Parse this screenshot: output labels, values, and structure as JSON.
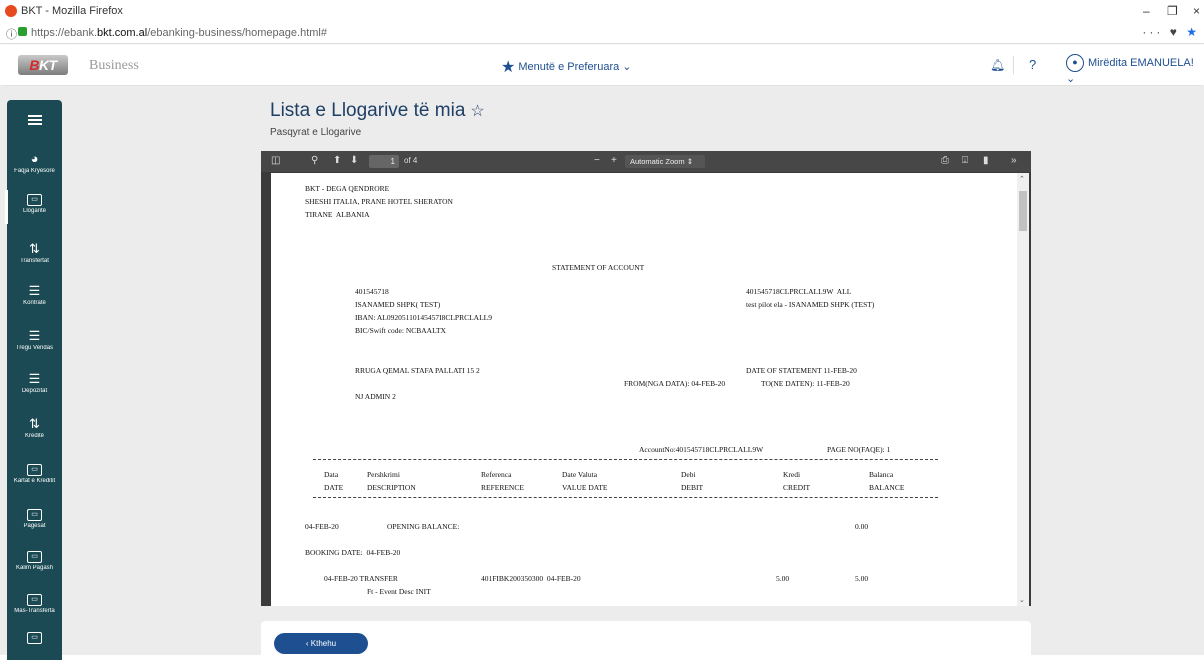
{
  "browser": {
    "window_title": "BKT - Mozilla Firefox",
    "url_prefix": "https://ebank.",
    "url_domain": "bkt.com.al",
    "url_path": "/ebanking-business/homepage.html#"
  },
  "header": {
    "logo_text": "BKT",
    "brand_sub": "Business",
    "favorites_menu": "Menutë e Preferuara",
    "help": "?",
    "user_name": "Mirëdita EMANUELA!"
  },
  "sidebar": {
    "items": [
      {
        "label": "Faqja Kryesore",
        "icon": "home-icon"
      },
      {
        "label": "Llogaritë",
        "icon": "accounts-icon"
      },
      {
        "label": "Transfertat",
        "icon": "transfer-icon"
      },
      {
        "label": "Kontratë",
        "icon": "contract-icon"
      },
      {
        "label": "Tregu Vendas",
        "icon": "market-icon"
      },
      {
        "label": "Depozitat",
        "icon": "deposit-icon"
      },
      {
        "label": "Kreditë",
        "icon": "credit-icon"
      },
      {
        "label": "Kartat e Kreditit",
        "icon": "card-icon"
      },
      {
        "label": "Pagesat",
        "icon": "payment-icon"
      },
      {
        "label": "Kalim Pagash",
        "icon": "payroll-icon"
      },
      {
        "label": "Mas-Transferta",
        "icon": "mass-transfer-icon"
      },
      {
        "label": "",
        "icon": "more-icon"
      }
    ]
  },
  "main": {
    "title": "Lista e Llogarive të mia",
    "breadcrumb": "Pasqyrat e Llogarive"
  },
  "pdf_viewer": {
    "page_current": "1",
    "page_total": "of 4",
    "zoom": "Automatic Zoom",
    "zoom_minus": "−",
    "zoom_plus": "+",
    "lines": {
      "bank1": "BKT - DEGA QENDRORE",
      "bank2": "SHESHI ITALIA, PRANE HOTEL SHERATON",
      "bank3": "TIRANE  ALBANIA",
      "statement_title": "STATEMENT OF ACCOUNT",
      "acct_no": "401545718",
      "acct_code": "401545718CLPRCLALL9W  ALL",
      "company": "ISANAMED SHPK( TEST)",
      "acct_desc": "test pilot ela - ISANAMED SHPK (TEST)",
      "iban": "IBAN: AL09205110145457I8CLPRCLALL9",
      "bic": "BIC/Swift code: NCBAALTX",
      "address": "RRUGA QEMAL STAFA PALLATI 15 2",
      "date_of_statement": "DATE OF STATEMENT 11-FEB-20",
      "from_date": "FROM(NGA DATA): 04-FEB-20",
      "to_date": "TO(NE DATEN): 11-FEB-20",
      "admin": "NJ ADMIN 2",
      "account_no_label": "AccountNo:401545718CLPRCLALL9W",
      "page_no": "PAGE NO(FAQE): 1",
      "col_data": "Data",
      "col_date": "DATE",
      "col_pershkrimi": "Pershkrimi",
      "col_description": "DESCRIPTION",
      "col_referenca": "Referenca",
      "col_reference": "REFERENCE",
      "col_date_valuta": "Date Valuta",
      "col_value_date": "VALUE DATE",
      "col_debi": "Debi",
      "col_debit": "DEBIT",
      "col_kredi": "Kredi",
      "col_credit": "CREDIT",
      "col_balanca": "Balanca",
      "col_balance": "BALANCE",
      "ob_date": "04-FEB-20",
      "ob_label": "OPENING BALANCE:",
      "ob_value": "0.00",
      "booking": "BOOKING DATE:  04-FEB-20",
      "tx_date": "04-FEB-20 TRANSFER",
      "tx_ref": "401FIBK200350300  04-FEB-20",
      "tx_credit": "5.00",
      "tx_balance": "5.00",
      "tx_desc": "Ft - Event Desc INIT"
    }
  },
  "footer": {
    "back_label": "‹  Kthehu"
  },
  "colors": {
    "sidebar": "#1b4a54",
    "primary": "#1e4f90",
    "title": "#1e3f66"
  }
}
